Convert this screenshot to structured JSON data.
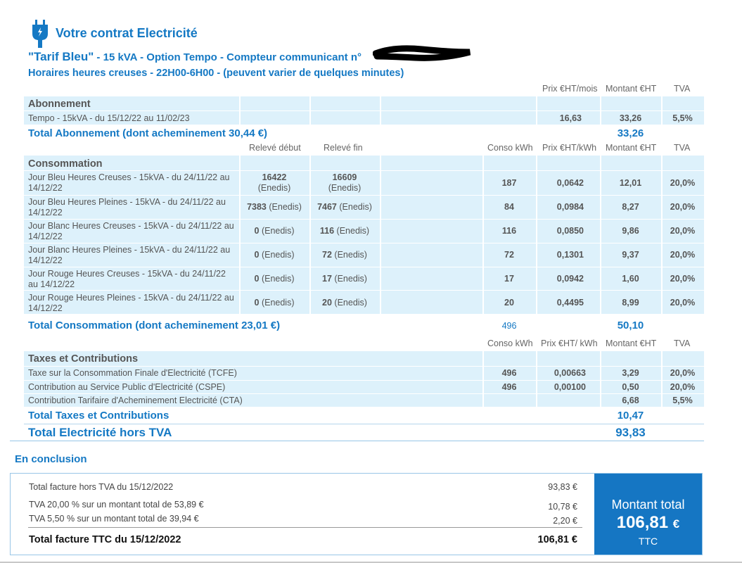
{
  "header": {
    "title": "Votre contrat Electricité",
    "tarif_name": "\"Tarif Bleu\"",
    "tarif_detail": " - 15 kVA - Option Tempo - Compteur communicant n°",
    "hours": "Horaires heures creuses - 22H00-6H00 - (peuvent varier de quelques minutes)"
  },
  "colors": {
    "brand_blue": "#1579c4",
    "band_blue": "#ddf1fb",
    "box_blue": "#1576c3"
  },
  "abonnement": {
    "headers": {
      "prix": "Prix €HT/mois",
      "montant": "Montant €HT",
      "tva": "TVA"
    },
    "section": "Abonnement",
    "row": {
      "label": "Tempo - 15kVA - du 15/12/22 au 11/02/23",
      "prix": "16,63",
      "montant": "33,26",
      "tva": "5,5%"
    },
    "total_label": "Total Abonnement (dont acheminement 30,44 €)",
    "total_value": "33,26"
  },
  "consommation": {
    "headers": {
      "debut": "Relevé début",
      "fin": "Relevé fin",
      "conso": "Conso kWh",
      "prix": "Prix €HT/kWh",
      "montant": "Montant €HT",
      "tva": "TVA"
    },
    "section": "Consommation",
    "rows": [
      {
        "label": "Jour Bleu Heures Creuses - 15kVA - du 24/11/22 au 14/12/22",
        "debut": "16422",
        "debut_src": "(Enedis)",
        "fin": "16609",
        "fin_src": "(Enedis)",
        "conso": "187",
        "prix": "0,0642",
        "montant": "12,01",
        "tva": "20,0%"
      },
      {
        "label": "Jour Bleu Heures Pleines - 15kVA - du 24/11/22 au 14/12/22",
        "debut": "7383",
        "debut_src": "(Enedis)",
        "fin": "7467",
        "fin_src": "(Enedis)",
        "conso": "84",
        "prix": "0,0984",
        "montant": "8,27",
        "tva": "20,0%"
      },
      {
        "label": "Jour Blanc Heures Creuses - 15kVA - du 24/11/22 au 14/12/22",
        "debut": "0",
        "debut_src": "(Enedis)",
        "fin": "116",
        "fin_src": "(Enedis)",
        "conso": "116",
        "prix": "0,0850",
        "montant": "9,86",
        "tva": "20,0%"
      },
      {
        "label": "Jour Blanc Heures Pleines - 15kVA - du 24/11/22 au 14/12/22",
        "debut": "0",
        "debut_src": "(Enedis)",
        "fin": "72",
        "fin_src": "(Enedis)",
        "conso": "72",
        "prix": "0,1301",
        "montant": "9,37",
        "tva": "20,0%"
      },
      {
        "label": "Jour Rouge Heures Creuses - 15kVA - du 24/11/22 au 14/12/22",
        "debut": "0",
        "debut_src": "(Enedis)",
        "fin": "17",
        "fin_src": "(Enedis)",
        "conso": "17",
        "prix": "0,0942",
        "montant": "1,60",
        "tva": "20,0%"
      },
      {
        "label": "Jour Rouge Heures Pleines - 15kVA - du 24/11/22 au 14/12/22",
        "debut": "0",
        "debut_src": "(Enedis)",
        "fin": "20",
        "fin_src": "(Enedis)",
        "conso": "20",
        "prix": "0,4495",
        "montant": "8,99",
        "tva": "20,0%"
      }
    ],
    "total_label": "Total Consommation (dont acheminement 23,01 €)",
    "total_conso": "496",
    "total_value": "50,10"
  },
  "taxes": {
    "headers": {
      "conso": "Conso kWh",
      "prix": "Prix €HT/ kWh",
      "montant": "Montant €HT",
      "tva": "TVA"
    },
    "section": "Taxes et Contributions",
    "rows": [
      {
        "label": "Taxe sur la Consommation Finale d'Electricité (TCFE)",
        "conso": "496",
        "prix": "0,00663",
        "montant": "3,29",
        "tva": "20,0%"
      },
      {
        "label": "Contribution au Service Public d'Electricité (CSPE)",
        "conso": "496",
        "prix": "0,00100",
        "montant": "0,50",
        "tva": "20,0%"
      },
      {
        "label": "Contribution Tarifaire d'Acheminement Electricité (CTA)",
        "conso": "",
        "prix": "",
        "montant": "6,68",
        "tva": "5,5%"
      }
    ],
    "total_label": "Total Taxes et Contributions",
    "total_value": "10,47",
    "grand_total_label": "Total Electricité hors TVA",
    "grand_total_value": "93,83"
  },
  "conclusion": {
    "title": "En conclusion",
    "lines": [
      {
        "label": "Total facture hors TVA du 15/12/2022",
        "value": "93,83 €"
      },
      {
        "label": "TVA 20,00 % sur un montant total de 53,89 €",
        "value": "10,78 €"
      },
      {
        "label": "TVA 5,50 % sur un montant total de 39,94 €",
        "value": "2,20 €"
      }
    ],
    "total_label": "Total facture TTC du 15/12/2022",
    "total_value": "106,81 €",
    "box_label": "Montant total",
    "box_value": "106,81",
    "box_currency": "€",
    "box_ttc": "TTC"
  }
}
